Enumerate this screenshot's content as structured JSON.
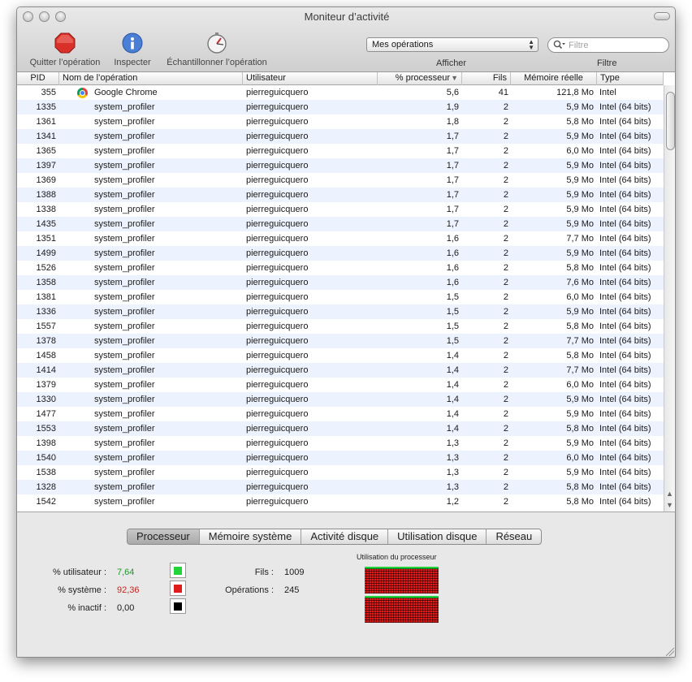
{
  "window": {
    "title": "Moniteur d’activité"
  },
  "toolbar": {
    "quit_label": "Quitter l’opération",
    "inspect_label": "Inspecter",
    "sample_label": "Échantillonner l’opération",
    "show_select_value": "Mes opérations",
    "show_label": "Afficher",
    "search_placeholder": "Filtre",
    "filter_label": "Filtre"
  },
  "table": {
    "columns": {
      "pid": "PID",
      "name": "Nom de l’opération",
      "user": "Utilisateur",
      "cpu": "% processeur",
      "threads": "Fils",
      "memory": "Mémoire réelle",
      "type": "Type"
    },
    "rows": [
      {
        "pid": "355",
        "name": "Google Chrome",
        "user": "pierreguicquero",
        "cpu": "5,6",
        "threads": "41",
        "memory": "121,8 Mo",
        "type": "Intel",
        "icon": "chrome-icon"
      },
      {
        "pid": "1335",
        "name": "system_profiler",
        "user": "pierreguicquero",
        "cpu": "1,9",
        "threads": "2",
        "memory": "5,9 Mo",
        "type": "Intel (64 bits)"
      },
      {
        "pid": "1361",
        "name": "system_profiler",
        "user": "pierreguicquero",
        "cpu": "1,8",
        "threads": "2",
        "memory": "5,8 Mo",
        "type": "Intel (64 bits)"
      },
      {
        "pid": "1341",
        "name": "system_profiler",
        "user": "pierreguicquero",
        "cpu": "1,7",
        "threads": "2",
        "memory": "5,9 Mo",
        "type": "Intel (64 bits)"
      },
      {
        "pid": "1365",
        "name": "system_profiler",
        "user": "pierreguicquero",
        "cpu": "1,7",
        "threads": "2",
        "memory": "6,0 Mo",
        "type": "Intel (64 bits)"
      },
      {
        "pid": "1397",
        "name": "system_profiler",
        "user": "pierreguicquero",
        "cpu": "1,7",
        "threads": "2",
        "memory": "5,9 Mo",
        "type": "Intel (64 bits)"
      },
      {
        "pid": "1369",
        "name": "system_profiler",
        "user": "pierreguicquero",
        "cpu": "1,7",
        "threads": "2",
        "memory": "5,9 Mo",
        "type": "Intel (64 bits)"
      },
      {
        "pid": "1388",
        "name": "system_profiler",
        "user": "pierreguicquero",
        "cpu": "1,7",
        "threads": "2",
        "memory": "5,9 Mo",
        "type": "Intel (64 bits)"
      },
      {
        "pid": "1338",
        "name": "system_profiler",
        "user": "pierreguicquero",
        "cpu": "1,7",
        "threads": "2",
        "memory": "5,9 Mo",
        "type": "Intel (64 bits)"
      },
      {
        "pid": "1435",
        "name": "system_profiler",
        "user": "pierreguicquero",
        "cpu": "1,7",
        "threads": "2",
        "memory": "5,9 Mo",
        "type": "Intel (64 bits)"
      },
      {
        "pid": "1351",
        "name": "system_profiler",
        "user": "pierreguicquero",
        "cpu": "1,6",
        "threads": "2",
        "memory": "7,7 Mo",
        "type": "Intel (64 bits)"
      },
      {
        "pid": "1499",
        "name": "system_profiler",
        "user": "pierreguicquero",
        "cpu": "1,6",
        "threads": "2",
        "memory": "5,9 Mo",
        "type": "Intel (64 bits)"
      },
      {
        "pid": "1526",
        "name": "system_profiler",
        "user": "pierreguicquero",
        "cpu": "1,6",
        "threads": "2",
        "memory": "5,8 Mo",
        "type": "Intel (64 bits)"
      },
      {
        "pid": "1358",
        "name": "system_profiler",
        "user": "pierreguicquero",
        "cpu": "1,6",
        "threads": "2",
        "memory": "7,6 Mo",
        "type": "Intel (64 bits)"
      },
      {
        "pid": "1381",
        "name": "system_profiler",
        "user": "pierreguicquero",
        "cpu": "1,5",
        "threads": "2",
        "memory": "6,0 Mo",
        "type": "Intel (64 bits)"
      },
      {
        "pid": "1336",
        "name": "system_profiler",
        "user": "pierreguicquero",
        "cpu": "1,5",
        "threads": "2",
        "memory": "5,9 Mo",
        "type": "Intel (64 bits)"
      },
      {
        "pid": "1557",
        "name": "system_profiler",
        "user": "pierreguicquero",
        "cpu": "1,5",
        "threads": "2",
        "memory": "5,8 Mo",
        "type": "Intel (64 bits)"
      },
      {
        "pid": "1378",
        "name": "system_profiler",
        "user": "pierreguicquero",
        "cpu": "1,5",
        "threads": "2",
        "memory": "7,7 Mo",
        "type": "Intel (64 bits)"
      },
      {
        "pid": "1458",
        "name": "system_profiler",
        "user": "pierreguicquero",
        "cpu": "1,4",
        "threads": "2",
        "memory": "5,8 Mo",
        "type": "Intel (64 bits)"
      },
      {
        "pid": "1414",
        "name": "system_profiler",
        "user": "pierreguicquero",
        "cpu": "1,4",
        "threads": "2",
        "memory": "7,7 Mo",
        "type": "Intel (64 bits)"
      },
      {
        "pid": "1379",
        "name": "system_profiler",
        "user": "pierreguicquero",
        "cpu": "1,4",
        "threads": "2",
        "memory": "6,0 Mo",
        "type": "Intel (64 bits)"
      },
      {
        "pid": "1330",
        "name": "system_profiler",
        "user": "pierreguicquero",
        "cpu": "1,4",
        "threads": "2",
        "memory": "5,9 Mo",
        "type": "Intel (64 bits)"
      },
      {
        "pid": "1477",
        "name": "system_profiler",
        "user": "pierreguicquero",
        "cpu": "1,4",
        "threads": "2",
        "memory": "5,9 Mo",
        "type": "Intel (64 bits)"
      },
      {
        "pid": "1553",
        "name": "system_profiler",
        "user": "pierreguicquero",
        "cpu": "1,4",
        "threads": "2",
        "memory": "5,8 Mo",
        "type": "Intel (64 bits)"
      },
      {
        "pid": "1398",
        "name": "system_profiler",
        "user": "pierreguicquero",
        "cpu": "1,3",
        "threads": "2",
        "memory": "5,9 Mo",
        "type": "Intel (64 bits)"
      },
      {
        "pid": "1540",
        "name": "system_profiler",
        "user": "pierreguicquero",
        "cpu": "1,3",
        "threads": "2",
        "memory": "6,0 Mo",
        "type": "Intel (64 bits)"
      },
      {
        "pid": "1538",
        "name": "system_profiler",
        "user": "pierreguicquero",
        "cpu": "1,3",
        "threads": "2",
        "memory": "5,9 Mo",
        "type": "Intel (64 bits)"
      },
      {
        "pid": "1328",
        "name": "system_profiler",
        "user": "pierreguicquero",
        "cpu": "1,3",
        "threads": "2",
        "memory": "5,8 Mo",
        "type": "Intel (64 bits)"
      },
      {
        "pid": "1542",
        "name": "system_profiler",
        "user": "pierreguicquero",
        "cpu": "1,2",
        "threads": "2",
        "memory": "5,8 Mo",
        "type": "Intel (64 bits)"
      }
    ]
  },
  "tabs": [
    {
      "label": "Processeur",
      "active": true
    },
    {
      "label": "Mémoire système",
      "active": false
    },
    {
      "label": "Activité disque",
      "active": false
    },
    {
      "label": "Utilisation disque",
      "active": false
    },
    {
      "label": "Réseau",
      "active": false
    }
  ],
  "cpu_panel": {
    "user_label": "% utilisateur :",
    "user_value": "7,64",
    "system_label": "% système :",
    "system_value": "92,36",
    "idle_label": "% inactif :",
    "idle_value": "0,00",
    "threads_label": "Fils :",
    "threads_value": "1009",
    "processes_label": "Opérations :",
    "processes_value": "245",
    "graph_title": "Utilisation du processeur",
    "graph_cores": [
      {
        "user_fraction": 0.08,
        "system_fraction": 0.92
      },
      {
        "user_fraction": 0.08,
        "system_fraction": 0.92
      }
    ],
    "colors": {
      "user": "#22d33a",
      "system": "#e01b1b",
      "idle": "#000000",
      "user_text": "#1d9a2c",
      "system_text": "#c0261f"
    }
  }
}
